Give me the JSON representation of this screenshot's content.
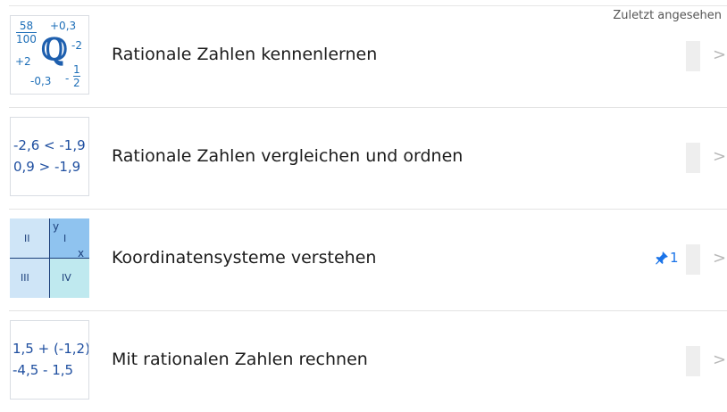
{
  "header": {
    "recent_label": "Zuletzt angesehen"
  },
  "rows": [
    {
      "title": "Rationale Zahlen kennenlernen",
      "thumb": {
        "frac1_num": "58",
        "frac1_den": "100",
        "plus03": "+0,3",
        "q": "ℚ",
        "minus2": "-2",
        "plus2": "+2",
        "minus03": "-0,3",
        "frac2_sign": "-",
        "frac2_num": "1",
        "frac2_den": "2"
      }
    },
    {
      "title": "Rationale Zahlen vergleichen und ordnen",
      "thumb": {
        "line1": "-2,6 < -1,9",
        "line2": "0,9 > -1,9"
      }
    },
    {
      "title": "Koordinatensysteme verstehen",
      "pin_count": "1",
      "thumb": {
        "q2": "II",
        "q1": "I",
        "q3": "III",
        "q4": "IV",
        "axis_x": "x",
        "axis_y": "y"
      }
    },
    {
      "title": "Mit rationalen Zahlen rechnen",
      "thumb": {
        "line1": "1,5 + (-1,2)",
        "line2": "-4,5 - 1,5"
      }
    }
  ],
  "icons": {
    "chevron": "chevron-right-icon",
    "pin": "pin-icon"
  },
  "colors": {
    "accent": "#1a73e8",
    "thumb_text": "#1e6fb8",
    "quadrant_dark": "#8fc3ef",
    "quadrant_light": "#cfe5f7",
    "quadrant_cyan": "#bfe9ef"
  },
  "chevron_glyph": ">"
}
